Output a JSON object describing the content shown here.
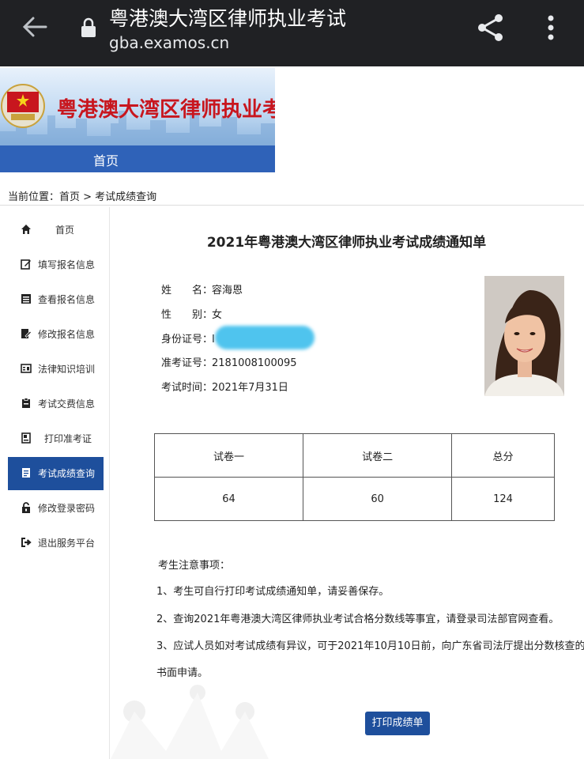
{
  "browser": {
    "title": "粤港澳大湾区律师执业考试",
    "url": "gba.examos.cn"
  },
  "banner": {
    "title": "粤港澳大湾区律师执业考",
    "nav_home": "首页"
  },
  "breadcrumb": "当前位置：首页 > 考试成绩查询",
  "sidebar": {
    "items": [
      {
        "label": "首页",
        "icon": "home-icon"
      },
      {
        "label": "填写报名信息",
        "icon": "edit-form-icon"
      },
      {
        "label": "查看报名信息",
        "icon": "list-icon"
      },
      {
        "label": "修改报名信息",
        "icon": "edit-doc-icon"
      },
      {
        "label": "法律知识培训",
        "icon": "training-icon"
      },
      {
        "label": "考试交费信息",
        "icon": "payment-icon"
      },
      {
        "label": "打印准考证",
        "icon": "id-card-icon"
      },
      {
        "label": "考试成绩查询",
        "icon": "score-icon"
      },
      {
        "label": "修改登录密码",
        "icon": "lock-icon"
      },
      {
        "label": "退出服务平台",
        "icon": "logout-icon"
      }
    ],
    "active_index": 7
  },
  "notice": {
    "title": "2021年粤港澳大湾区律师执业考试成绩通知单",
    "name_label": "姓　　名：",
    "name": "容海恩",
    "gender_label": "性　　别：",
    "gender": "女",
    "id_label": "身份证号：",
    "id_value": "I",
    "ticket_label": "准考证号：",
    "ticket": "2181008100095",
    "date_label": "考试时间：",
    "date": "2021年7月31日"
  },
  "scores": {
    "headers": [
      "试卷一",
      "试卷二",
      "总分"
    ],
    "values": [
      "64",
      "60",
      "124"
    ]
  },
  "notes": {
    "heading": "考生注意事项：",
    "items": [
      "1、考生可自行打印考试成绩通知单，请妥善保存。",
      "2、查询2021年粤港澳大湾区律师执业考试合格分数线等事宜，请登录司法部官网查看。",
      "3、应试人员如对考试成绩有异议，可于2021年10月10日前，向广东省司法厅提出分数核查的",
      "书面申请。"
    ]
  },
  "print_button": "打印成绩单",
  "colors": {
    "topbar": "#202124",
    "nav": "#2f62b8",
    "active": "#1e4f9c",
    "banner_text": "#c8161e"
  }
}
